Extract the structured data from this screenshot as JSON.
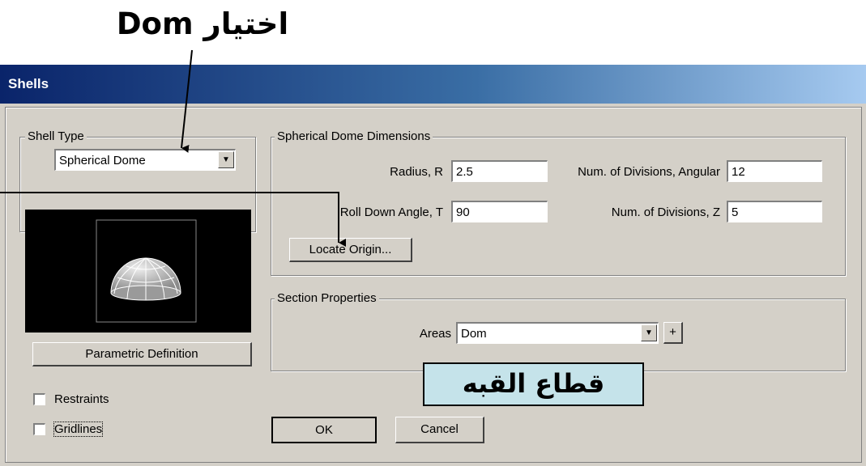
{
  "annotations": {
    "top_label": "اختيار Dom",
    "section_label": "قطاع القبه"
  },
  "window": {
    "title": "Shells"
  },
  "shell_type": {
    "group_label": "Shell Type",
    "selected": "Spherical Dome"
  },
  "parametric_button": "Parametric Definition",
  "dimensions": {
    "group_label": "Spherical Dome Dimensions",
    "radius_label": "Radius, R",
    "radius_value": "2.5",
    "angular_label": "Num. of Divisions, Angular",
    "angular_value": "12",
    "rolldown_label": "Roll Down Angle, T",
    "rolldown_value": "90",
    "z_label": "Num. of Divisions, Z",
    "z_value": "5",
    "locate_button": "Locate Origin..."
  },
  "section": {
    "group_label": "Section Properties",
    "areas_label": "Areas",
    "areas_value": "Dom",
    "add_button": "+"
  },
  "checkboxes": {
    "restraints": "Restraints",
    "gridlines": "Gridlines"
  },
  "buttons": {
    "ok": "OK",
    "cancel": "Cancel"
  },
  "colors": {
    "title_gradient_start": "#0a246a",
    "title_gradient_end": "#a6caf0",
    "dialog_face": "#d4d0c8",
    "annotation_box": "#c5e3ea"
  }
}
